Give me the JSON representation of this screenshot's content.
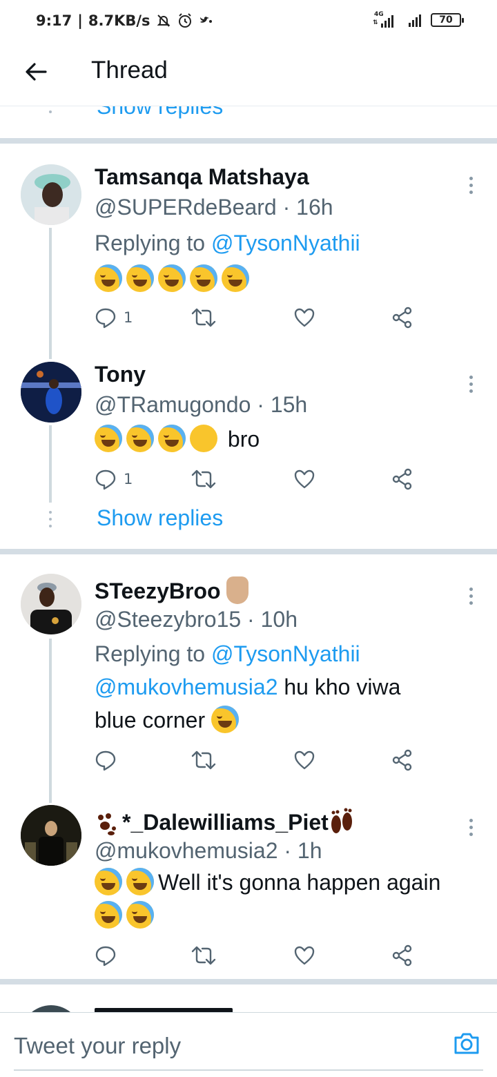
{
  "status_bar": {
    "time": "9:17",
    "speed": "8.7KB/s",
    "network": "4G",
    "battery": "70"
  },
  "header": {
    "title": "Thread"
  },
  "show_replies_label": "Show replies",
  "tweets": [
    {
      "name": "Tamsanqa Matshaya",
      "handle": "@SUPERdeBeard",
      "time": "16h",
      "replying_label": "Replying to",
      "replying_to": "@TysonNyathii",
      "text": "",
      "emojis": [
        "joy",
        "sweat-smile",
        "rofl",
        "rofl",
        "rofl"
      ],
      "reply_count": "1"
    },
    {
      "name": "Tony",
      "handle": "@TRamugondo",
      "time": "15h",
      "text": "bro",
      "emojis": [
        "rofl",
        "rofl",
        "rofl",
        "facepalm"
      ],
      "reply_count": "1"
    },
    {
      "name": "STeezyBroo",
      "name_emoji": "victory-hand",
      "handle": "@Steezybro15",
      "time": "10h",
      "replying_label": "Replying to",
      "replying_to": "@TysonNyathii",
      "mention": "@mukovhemusia2",
      "text_line1": " hu kho viwa",
      "text_line2": "blue corner",
      "emojis": [
        "rofl"
      ],
      "reply_count": ""
    },
    {
      "name": "*_Dalewilliams_Piet",
      "name_emojis": [
        "paw-prints",
        "footprints"
      ],
      "handle": "@mukovhemusia2",
      "time": "1h",
      "text": "Well it's gonna happen again",
      "emojis": [
        "joy",
        "joy",
        "sweat-smile",
        "sweat-smile"
      ],
      "reply_count": ""
    }
  ],
  "composer": {
    "placeholder": "Tweet your reply"
  },
  "colors": {
    "link": "#1d9bf0",
    "secondary_text": "#536471",
    "separator": "#d4dde4",
    "emoji_yellow": "#f9c52c"
  }
}
